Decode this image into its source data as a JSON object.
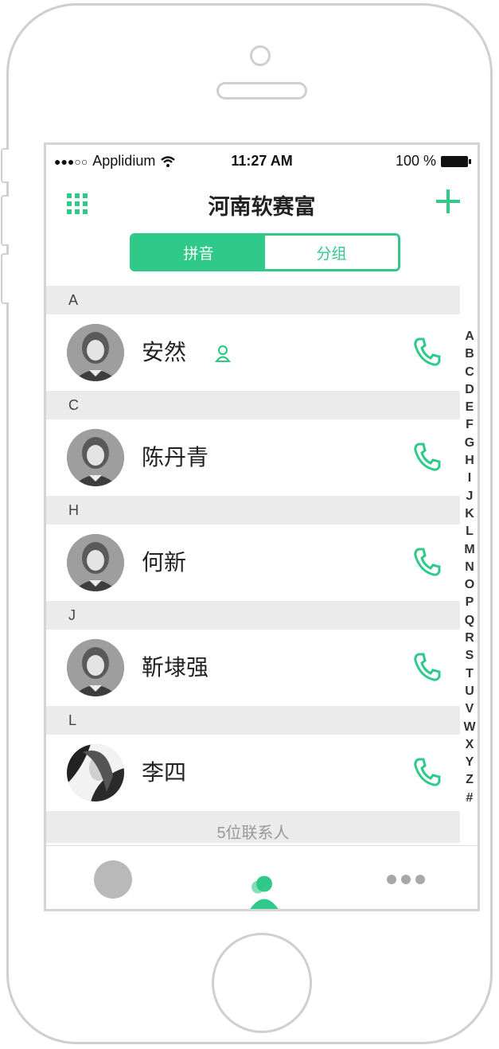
{
  "status_bar": {
    "signal": "●●●○○",
    "carrier": "Applidium",
    "time": "11:27 AM",
    "battery": "100 %"
  },
  "nav": {
    "title": "河南软赛富",
    "left_icon": "grid-icon",
    "right_icon": "plus-icon"
  },
  "segments": [
    {
      "label": "拼音",
      "active": true
    },
    {
      "label": "分组",
      "active": false
    }
  ],
  "contacts": [
    {
      "section": "A",
      "name": "安然",
      "has_user_badge": true
    },
    {
      "section": "C",
      "name": "陈丹青",
      "has_user_badge": false
    },
    {
      "section": "H",
      "name": "何新",
      "has_user_badge": false
    },
    {
      "section": "J",
      "name": "靳埭强",
      "has_user_badge": false
    },
    {
      "section": "L",
      "name": "李四",
      "has_user_badge": false
    }
  ],
  "footer": "5位联系人",
  "index_letters": [
    "A",
    "B",
    "C",
    "D",
    "E",
    "F",
    "G",
    "H",
    "I",
    "J",
    "K",
    "L",
    "M",
    "N",
    "O",
    "P",
    "Q",
    "R",
    "S",
    "T",
    "U",
    "V",
    "W",
    "X",
    "Y",
    "Z",
    "#"
  ],
  "tabs": [
    {
      "icon": "home-dot-icon"
    },
    {
      "icon": "contacts-icon",
      "active": true
    },
    {
      "icon": "more-icon"
    }
  ],
  "colors": {
    "accent": "#2fc98a",
    "section_bg": "#ebebeb"
  }
}
